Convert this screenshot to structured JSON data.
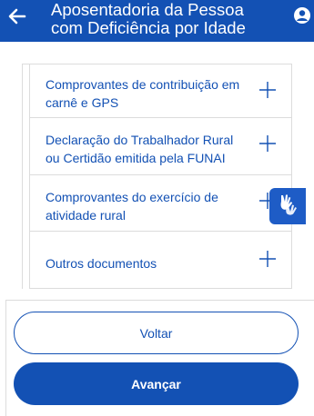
{
  "header": {
    "title_line1": "Aposentadoria da Pessoa",
    "title_line2": "com Deficiência por Idade"
  },
  "documents": [
    {
      "label_line1": "Comprovantes de contribuição em",
      "label_line2": "carnê e GPS"
    },
    {
      "label_line1": "Declaração do Trabalhador Rural",
      "label_line2": "ou Certidão emitida pela FUNAI"
    },
    {
      "label_line1": "Comprovantes do exercício de",
      "label_line2": "atividade rural"
    },
    {
      "label_line1": "Outros documentos",
      "label_line2": ""
    }
  ],
  "buttons": {
    "back_label": "Voltar",
    "next_label": "Avançar"
  },
  "icons": {
    "back": "arrow-left-icon",
    "user": "user-circle-icon",
    "expand": "plus-icon",
    "accessibility": "sign-language-hands-icon"
  },
  "colors": {
    "primary": "#1351b4",
    "accessibility": "#1e5cc6",
    "border": "#dcdcdc",
    "background": "#ffffff"
  }
}
